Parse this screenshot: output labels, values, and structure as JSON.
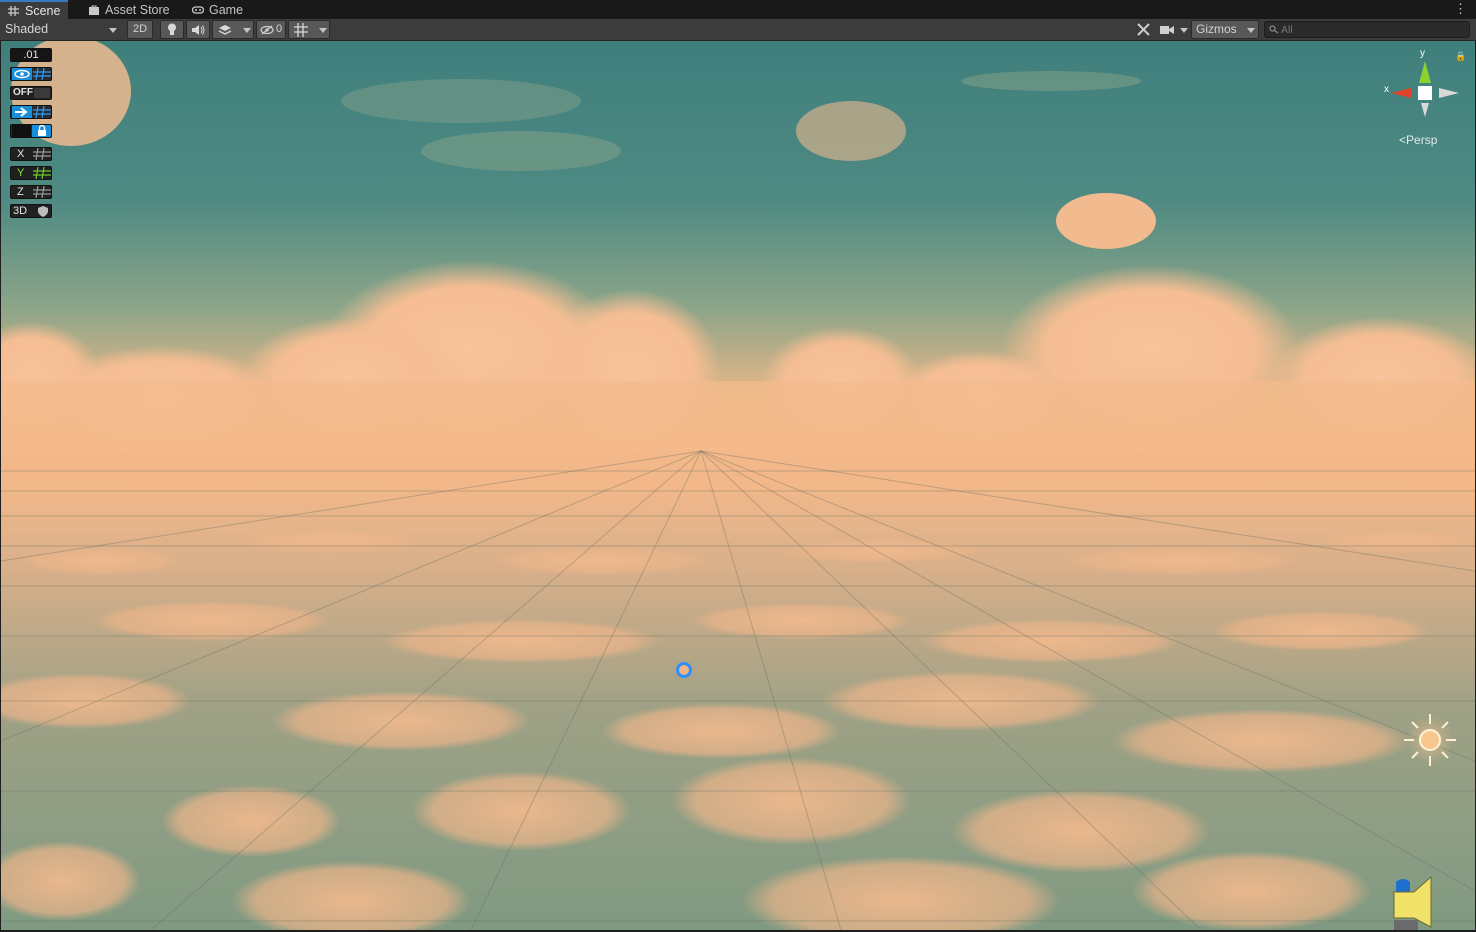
{
  "tabs": [
    {
      "label": "Scene",
      "icon": "grid-icon",
      "active": true
    },
    {
      "label": "Asset Store",
      "icon": "bag-icon",
      "active": false
    },
    {
      "label": "Game",
      "icon": "gamepad-icon",
      "active": false
    }
  ],
  "toolbar": {
    "shading_mode": "Shaded",
    "toggle_2d": "2D",
    "hidden_count": "0",
    "gizmos_label": "Gizmos",
    "search_placeholder": "All"
  },
  "snap_overlay": {
    "increment": ".01",
    "toggle_state": "OFF",
    "axes": [
      "X",
      "Y",
      "Z"
    ],
    "mode": "3D"
  },
  "orientation_gizmo": {
    "y_label": "y",
    "x_label": "x",
    "projection_label": "Persp"
  },
  "colors": {
    "accent": "#3a79bb",
    "gizmo_x": "#e0452b",
    "gizmo_y": "#8bd12f",
    "selection": "#2f8fff"
  }
}
